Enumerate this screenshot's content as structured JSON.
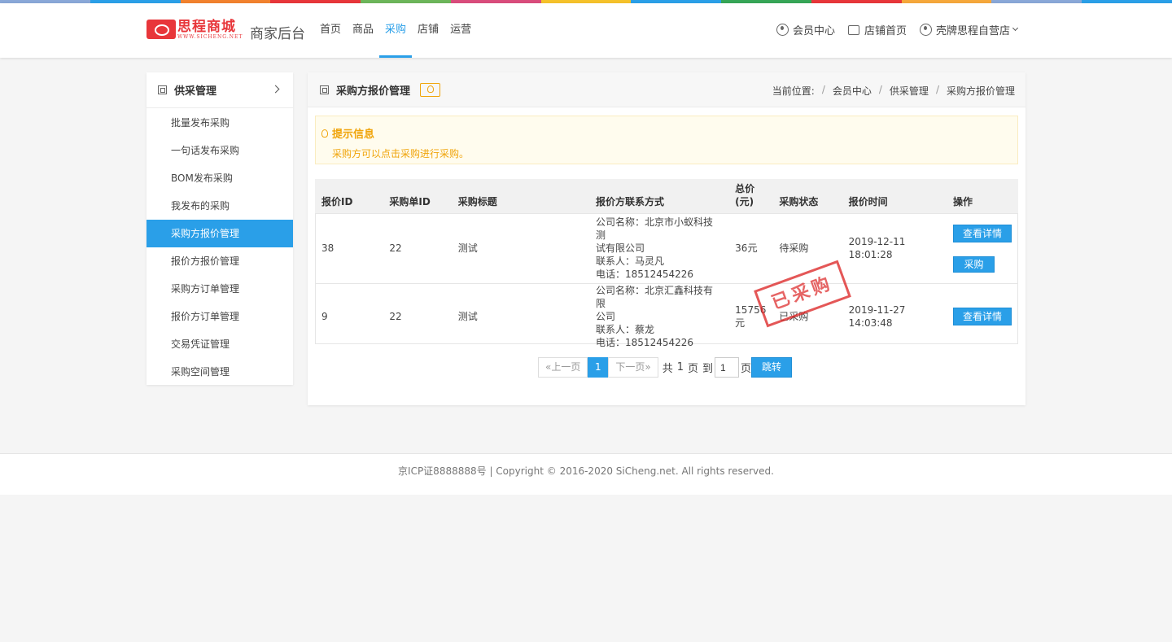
{
  "strip_colors": [
    "#8aa8d8",
    "#2a9fe8",
    "#f2822e",
    "#e8363a",
    "#6cb65a",
    "#d94c7c",
    "#f5c22a",
    "#2a9fe8",
    "#36a657",
    "#e8363a",
    "#f6a83b",
    "#8aa8d8",
    "#2a9fe8"
  ],
  "brand": {
    "logo_cn": "思程商城",
    "logo_en": "WWW.SICHENG.NET",
    "subtitle": "商家后台",
    "accent": "#2a9fe8"
  },
  "nav": [
    {
      "label": "首页",
      "active": false
    },
    {
      "label": "商品",
      "active": false
    },
    {
      "label": "采购",
      "active": true
    },
    {
      "label": "店铺",
      "active": false
    },
    {
      "label": "运营",
      "active": false
    }
  ],
  "top_right": {
    "member_center": "会员中心",
    "shop_home": "店铺首页",
    "store_name": "壳牌思程自营店"
  },
  "sidebar": {
    "title": "供采管理",
    "items": [
      {
        "label": "批量发布采购",
        "active": false
      },
      {
        "label": "一句话发布采购",
        "active": false
      },
      {
        "label": "BOM发布采购",
        "active": false
      },
      {
        "label": "我发布的采购",
        "active": false
      },
      {
        "label": "采购方报价管理",
        "active": true
      },
      {
        "label": "报价方报价管理",
        "active": false
      },
      {
        "label": "采购方订单管理",
        "active": false
      },
      {
        "label": "报价方订单管理",
        "active": false
      },
      {
        "label": "交易凭证管理",
        "active": false
      },
      {
        "label": "采购空间管理",
        "active": false
      }
    ]
  },
  "main": {
    "title": "采购方报价管理",
    "breadcrumb": {
      "label": "当前位置:",
      "items": [
        "会员中心",
        "供采管理",
        "采购方报价管理"
      ]
    },
    "tip": {
      "title": "提示信息",
      "text": "采购方可以点击采购进行采购。"
    },
    "table": {
      "headers": [
        "报价ID",
        "采购单ID",
        "采购标题",
        "报价方联系方式",
        "总价\n(元)",
        "采购状态",
        "报价时间",
        "操作"
      ],
      "rows": [
        {
          "id": "38",
          "order_id": "22",
          "title": "测试",
          "contact": [
            "公司名称：北京市小蚁科技测",
            "试有限公司",
            "联系人：马灵凡",
            "电话：18512454226"
          ],
          "price": "36元",
          "status": "待采购",
          "time": [
            "2019-12-11",
            "18:01:28"
          ],
          "detail_label": "查看详情",
          "buy_label": "采购",
          "stamp": ""
        },
        {
          "id": "9",
          "order_id": "22",
          "title": "测试",
          "contact": [
            "公司名称：北京汇鑫科技有限",
            "公司",
            "联系人：蔡龙",
            "电话：18512454226"
          ],
          "price": "15756",
          "price_unit": "元",
          "status": "已采购",
          "time": [
            "2019-11-27",
            "14:03:48"
          ],
          "detail_label": "查看详情",
          "buy_label": "",
          "stamp": "已采购"
        }
      ]
    },
    "pager": {
      "prev": "«上一页",
      "current": "1",
      "next": "下一页»",
      "total_prefix": "共",
      "total": "1",
      "page_word": "页",
      "goto_prefix": "到",
      "input_value": "1",
      "goto_suffix": "页",
      "go_label": "跳转"
    }
  },
  "footer": {
    "text": "京ICP证8888888号 | Copyright © 2016-2020 SiCheng.net. All rights reserved."
  }
}
